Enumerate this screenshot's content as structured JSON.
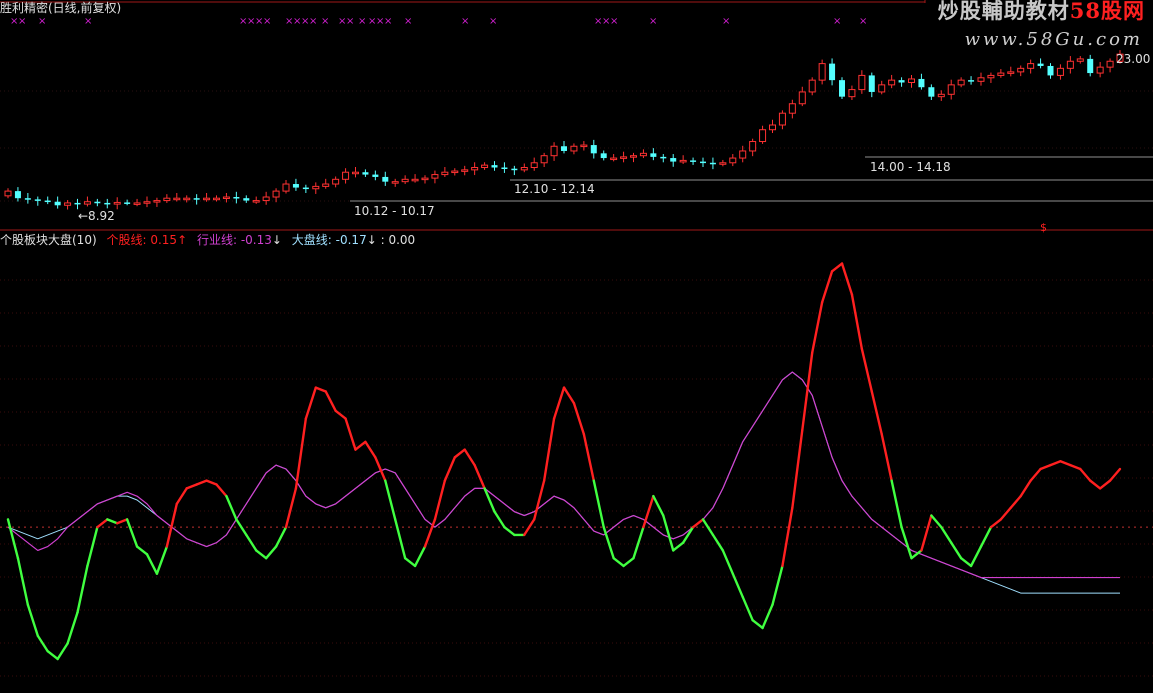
{
  "header": {
    "title": "胜利精密(日线,前复权)",
    "watermark_brand": "炒股輔助教材",
    "watermark_brand_highlight": "58股网",
    "watermark_url": "www.58Gu.com",
    "top_price_label": "23.00"
  },
  "price_annotations": [
    {
      "text": "←8.92"
    },
    {
      "text": "10.12 - 10.17"
    },
    {
      "text": "12.10 - 12.14"
    },
    {
      "text": "14.00 - 14.18"
    }
  ],
  "indicator": {
    "name": "个股板块大盘(10)",
    "stock_label": "个股线:",
    "stock_value": "0.15",
    "stock_arrow": "↑",
    "sector_label": "行业线:",
    "sector_value": "-0.13",
    "sector_arrow": "↓",
    "market_label": "大盘线:",
    "market_value": "-0.17",
    "market_arrow": "↓",
    "extra": ": 0.00",
    "marker": "$"
  },
  "colors": {
    "up": "#ff3232",
    "down": "#54ffff",
    "stock_up": "#ff2020",
    "stock_down": "#40ff40",
    "sector": "#d040d0",
    "market": "#a0e0ff",
    "marker": "#d020d0"
  },
  "chart_data": [
    {
      "type": "candlestick",
      "x": [
        "1",
        "2",
        "3",
        "4",
        "5",
        "6",
        "7",
        "8",
        "9",
        "10",
        "11",
        "12",
        "13",
        "14",
        "15",
        "16",
        "17",
        "18",
        "19",
        "20",
        "21",
        "22",
        "23",
        "24",
        "25",
        "26",
        "27",
        "28",
        "29",
        "30",
        "31",
        "32",
        "33",
        "34",
        "35",
        "36",
        "37",
        "38",
        "39",
        "40",
        "41",
        "42",
        "43",
        "44",
        "45",
        "46",
        "47",
        "48",
        "49",
        "50",
        "51",
        "52",
        "53",
        "54",
        "55",
        "56",
        "57",
        "58",
        "59",
        "60",
        "61",
        "62",
        "63",
        "64",
        "65",
        "66",
        "67",
        "68",
        "69",
        "70",
        "71",
        "72",
        "73",
        "74",
        "75",
        "76",
        "77",
        "78",
        "79",
        "80",
        "81",
        "82",
        "83",
        "84",
        "85",
        "86",
        "87",
        "88",
        "89",
        "90",
        "91",
        "92",
        "93",
        "94",
        "95",
        "96",
        "97",
        "98",
        "99",
        "100",
        "101",
        "102",
        "103",
        "104",
        "105",
        "106",
        "107",
        "108",
        "109",
        "110",
        "111",
        "112",
        "113"
      ],
      "close": [
        9.6,
        9.3,
        9.25,
        9.2,
        9.15,
        9.0,
        9.1,
        9.05,
        9.15,
        9.1,
        9.05,
        9.12,
        9.1,
        9.1,
        9.15,
        9.2,
        9.3,
        9.3,
        9.3,
        9.25,
        9.3,
        9.3,
        9.35,
        9.3,
        9.2,
        9.2,
        9.35,
        9.6,
        9.9,
        9.75,
        9.7,
        9.8,
        9.9,
        10.1,
        10.4,
        10.4,
        10.3,
        10.2,
        10.0,
        10.0,
        10.1,
        10.1,
        10.15,
        10.3,
        10.4,
        10.45,
        10.5,
        10.6,
        10.7,
        10.6,
        10.55,
        10.5,
        10.6,
        10.8,
        11.1,
        11.5,
        11.3,
        11.5,
        11.55,
        11.2,
        11.0,
        11.0,
        11.05,
        11.1,
        11.2,
        11.05,
        11.0,
        10.85,
        10.9,
        10.85,
        10.8,
        10.75,
        10.8,
        11.0,
        11.3,
        11.7,
        12.2,
        12.4,
        12.9,
        13.3,
        13.8,
        14.3,
        15.0,
        14.3,
        13.6,
        13.9,
        14.5,
        13.8,
        14.1,
        14.3,
        14.2,
        14.35,
        14.0,
        13.6,
        13.7,
        14.1,
        14.3,
        14.25,
        14.4,
        14.5,
        14.6,
        14.65,
        14.8,
        15.0,
        14.9,
        14.5,
        14.8,
        15.1,
        15.2,
        14.6,
        14.85,
        15.1,
        15.4
      ],
      "open": [
        9.4,
        9.6,
        9.3,
        9.25,
        9.2,
        9.15,
        9.0,
        9.1,
        9.05,
        9.15,
        9.1,
        9.05,
        9.12,
        9.1,
        9.1,
        9.15,
        9.2,
        9.3,
        9.3,
        9.3,
        9.25,
        9.3,
        9.3,
        9.35,
        9.3,
        9.2,
        9.2,
        9.35,
        9.6,
        9.9,
        9.75,
        9.7,
        9.8,
        9.9,
        10.1,
        10.4,
        10.4,
        10.3,
        10.2,
        10.0,
        10.0,
        10.1,
        10.1,
        10.15,
        10.3,
        10.4,
        10.45,
        10.5,
        10.6,
        10.7,
        10.6,
        10.55,
        10.5,
        10.6,
        10.8,
        11.1,
        11.5,
        11.3,
        11.5,
        11.55,
        11.2,
        11.0,
        11.0,
        11.05,
        11.1,
        11.2,
        11.05,
        11.0,
        10.85,
        10.9,
        10.85,
        10.8,
        10.75,
        10.8,
        11.0,
        11.3,
        11.7,
        12.2,
        12.4,
        12.9,
        13.3,
        13.8,
        14.3,
        15.0,
        14.3,
        13.6,
        13.9,
        14.5,
        13.8,
        14.1,
        14.3,
        14.2,
        14.35,
        14.0,
        13.6,
        13.7,
        14.1,
        14.3,
        14.25,
        14.4,
        14.5,
        14.6,
        14.65,
        14.8,
        15.0,
        14.9,
        14.5,
        14.8,
        15.1,
        15.2,
        14.6,
        14.85,
        15.1
      ],
      "annotated_low": 8.92
    },
    {
      "type": "line",
      "title": "个股板块大盘(10)",
      "x": [
        "1",
        "2",
        "3",
        "4",
        "5",
        "6",
        "7",
        "8",
        "9",
        "10",
        "11",
        "12",
        "13",
        "14",
        "15",
        "16",
        "17",
        "18",
        "19",
        "20",
        "21",
        "22",
        "23",
        "24",
        "25",
        "26",
        "27",
        "28",
        "29",
        "30",
        "31",
        "32",
        "33",
        "34",
        "35",
        "36",
        "37",
        "38",
        "39",
        "40",
        "41",
        "42",
        "43",
        "44",
        "45",
        "46",
        "47",
        "48",
        "49",
        "50",
        "51",
        "52",
        "53",
        "54",
        "55",
        "56",
        "57",
        "58",
        "59",
        "60",
        "61",
        "62",
        "63",
        "64",
        "65",
        "66",
        "67",
        "68",
        "69",
        "70",
        "71",
        "72",
        "73",
        "74",
        "75",
        "76",
        "77",
        "78",
        "79",
        "80",
        "81",
        "82",
        "83",
        "84",
        "85",
        "86",
        "87",
        "88",
        "89",
        "90",
        "91",
        "92",
        "93",
        "94",
        "95",
        "96",
        "97",
        "98",
        "99",
        "100",
        "101",
        "102",
        "103",
        "104",
        "105",
        "106",
        "107",
        "108",
        "109",
        "110",
        "111",
        "112",
        "113"
      ],
      "reference_level": 0,
      "series": [
        {
          "name": "个股线",
          "values": [
            0.02,
            -0.08,
            -0.2,
            -0.28,
            -0.32,
            -0.34,
            -0.3,
            -0.22,
            -0.1,
            0.0,
            0.02,
            0.01,
            0.02,
            -0.05,
            -0.07,
            -0.12,
            -0.05,
            0.06,
            0.1,
            0.11,
            0.12,
            0.11,
            0.08,
            0.02,
            -0.02,
            -0.06,
            -0.08,
            -0.05,
            0.0,
            0.1,
            0.28,
            0.36,
            0.35,
            0.3,
            0.28,
            0.2,
            0.22,
            0.18,
            0.12,
            0.02,
            -0.08,
            -0.1,
            -0.05,
            0.02,
            0.12,
            0.18,
            0.2,
            0.16,
            0.1,
            0.04,
            0.0,
            -0.02,
            -0.02,
            0.02,
            0.12,
            0.28,
            0.36,
            0.32,
            0.24,
            0.12,
            0.0,
            -0.08,
            -0.1,
            -0.08,
            0.0,
            0.08,
            0.03,
            -0.06,
            -0.04,
            0.0,
            0.02,
            -0.02,
            -0.06,
            -0.12,
            -0.18,
            -0.24,
            -0.26,
            -0.2,
            -0.1,
            0.05,
            0.25,
            0.45,
            0.58,
            0.66,
            0.68,
            0.6,
            0.46,
            0.35,
            0.24,
            0.12,
            0.0,
            -0.08,
            -0.06,
            0.03,
            0.0,
            -0.04,
            -0.08,
            -0.1,
            -0.05,
            0.0,
            0.02,
            0.05,
            0.08,
            0.12,
            0.15,
            0.16,
            0.17,
            0.16,
            0.15,
            0.12,
            0.1,
            0.12,
            0.15
          ]
        },
        {
          "name": "行业线",
          "values": [
            0.0,
            -0.02,
            -0.04,
            -0.06,
            -0.05,
            -0.03,
            0.0,
            0.02,
            0.04,
            0.06,
            0.07,
            0.08,
            0.09,
            0.08,
            0.06,
            0.03,
            0.01,
            -0.01,
            -0.03,
            -0.04,
            -0.05,
            -0.04,
            -0.02,
            0.02,
            0.06,
            0.1,
            0.14,
            0.16,
            0.15,
            0.12,
            0.08,
            0.06,
            0.05,
            0.06,
            0.08,
            0.1,
            0.12,
            0.14,
            0.15,
            0.14,
            0.1,
            0.06,
            0.02,
            0.0,
            0.02,
            0.05,
            0.08,
            0.1,
            0.1,
            0.08,
            0.06,
            0.04,
            0.03,
            0.04,
            0.06,
            0.08,
            0.07,
            0.05,
            0.02,
            -0.01,
            -0.02,
            0.0,
            0.02,
            0.03,
            0.02,
            0.0,
            -0.02,
            -0.03,
            -0.02,
            0.0,
            0.02,
            0.05,
            0.1,
            0.16,
            0.22,
            0.26,
            0.3,
            0.34,
            0.38,
            0.4,
            0.38,
            0.34,
            0.26,
            0.18,
            0.12,
            0.08,
            0.05,
            0.02,
            0.0,
            -0.02,
            -0.04,
            -0.06,
            -0.07,
            -0.08,
            -0.09,
            -0.1,
            -0.11,
            -0.12,
            -0.13,
            -0.13,
            -0.13,
            -0.13,
            -0.13,
            -0.13,
            -0.13,
            -0.13,
            -0.13,
            -0.13,
            -0.13,
            -0.13,
            -0.13,
            -0.13,
            -0.13
          ]
        },
        {
          "name": "大盘线",
          "values": [
            0.0,
            -0.01,
            -0.02,
            -0.03,
            -0.02,
            -0.01,
            0.0,
            0.02,
            0.04,
            0.06,
            0.07,
            0.08,
            0.08,
            0.07,
            0.05,
            0.03,
            0.01,
            -0.01,
            -0.03,
            -0.04,
            -0.05,
            -0.04,
            -0.02,
            0.02,
            0.06,
            0.1,
            0.14,
            0.16,
            0.15,
            0.12,
            0.08,
            0.06,
            0.05,
            0.06,
            0.08,
            0.1,
            0.12,
            0.14,
            0.15,
            0.14,
            0.1,
            0.06,
            0.02,
            0.0,
            0.02,
            0.05,
            0.08,
            0.1,
            0.1,
            0.08,
            0.06,
            0.04,
            0.03,
            0.04,
            0.06,
            0.08,
            0.07,
            0.05,
            0.02,
            -0.01,
            -0.02,
            0.0,
            0.02,
            0.03,
            0.02,
            0.0,
            -0.02,
            -0.03,
            -0.02,
            0.0,
            0.02,
            0.05,
            0.1,
            0.16,
            0.22,
            0.26,
            0.3,
            0.34,
            0.38,
            0.4,
            0.38,
            0.34,
            0.26,
            0.18,
            0.12,
            0.08,
            0.05,
            0.02,
            0.0,
            -0.02,
            -0.04,
            -0.06,
            -0.07,
            -0.08,
            -0.09,
            -0.1,
            -0.11,
            -0.12,
            -0.13,
            -0.14,
            -0.15,
            -0.16,
            -0.17,
            -0.17,
            -0.17,
            -0.17,
            -0.17,
            -0.17,
            -0.17,
            -0.17,
            -0.17,
            -0.17,
            -0.17
          ]
        }
      ]
    }
  ]
}
